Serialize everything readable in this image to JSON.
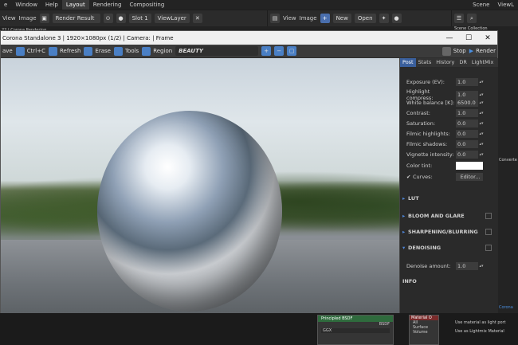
{
  "menu": {
    "items": [
      "Window",
      "Help"
    ],
    "left_cut": "e"
  },
  "workspace_tabs": [
    "Layout",
    "Rendering",
    "Compositing"
  ],
  "scene": "Scene",
  "view_layer_top": "ViewL",
  "image_editor": {
    "view": "View",
    "image": "Image",
    "render_result": "Render Result",
    "slot": "Slot 1",
    "view_layer": "ViewLayer"
  },
  "file_header": {
    "view": "View",
    "image": "Image",
    "new": "New",
    "open": "Open"
  },
  "collection": "Scene Collection",
  "under_text": "22 | Corona Rendering",
  "window": {
    "title": "Corona Standalone 3 | 1920×1080px (1/2) | Camera: | Frame",
    "minimize": "—",
    "maximize": "☐",
    "close": "✕"
  },
  "toolbar": {
    "save": "ave",
    "copy": "Ctrl+C",
    "refresh": "Refresh",
    "erase": "Erase",
    "tools": "Tools",
    "region": "Region",
    "pass": "BEAUTY",
    "stop": "Stop",
    "render": "Render"
  },
  "panel": {
    "tabs": [
      "Post",
      "Stats",
      "History",
      "DR",
      "LightMix"
    ],
    "rows": [
      {
        "label": "Exposure (EV):",
        "value": "1.0"
      },
      {
        "label": "Highlight compress:",
        "value": "1.0"
      },
      {
        "label": "White balance [K]:",
        "value": "6500.0"
      },
      {
        "label": "Contrast:",
        "value": "1.0"
      },
      {
        "label": "Saturation:",
        "value": "0.0"
      },
      {
        "label": "Filmic highlights:",
        "value": "0.0"
      },
      {
        "label": "Filmic shadows:",
        "value": "0.0"
      },
      {
        "label": "Vignette intensity:",
        "value": "0.0"
      }
    ],
    "color_tint": "Color tint:",
    "curves": "Curves:",
    "editor": "Editor...",
    "sections": [
      "LUT",
      "BLOOM AND GLARE",
      "SHARPENING/BLURRING",
      "DENOISING"
    ],
    "denoise_label": "Denoise amount:",
    "denoise_value": "1.0",
    "info": "INFO"
  },
  "right_edge": {
    "converter": "Converte",
    "corona": "Corona"
  },
  "node": {
    "title": "Principled BSDF",
    "bsdf": "BSDF",
    "ggx": "GGX",
    "material": "Material O",
    "all": "All",
    "surface": "Surface",
    "volume": "Volume"
  },
  "material_opts": [
    "Use material as light port",
    "Use as Lightmix Material"
  ]
}
